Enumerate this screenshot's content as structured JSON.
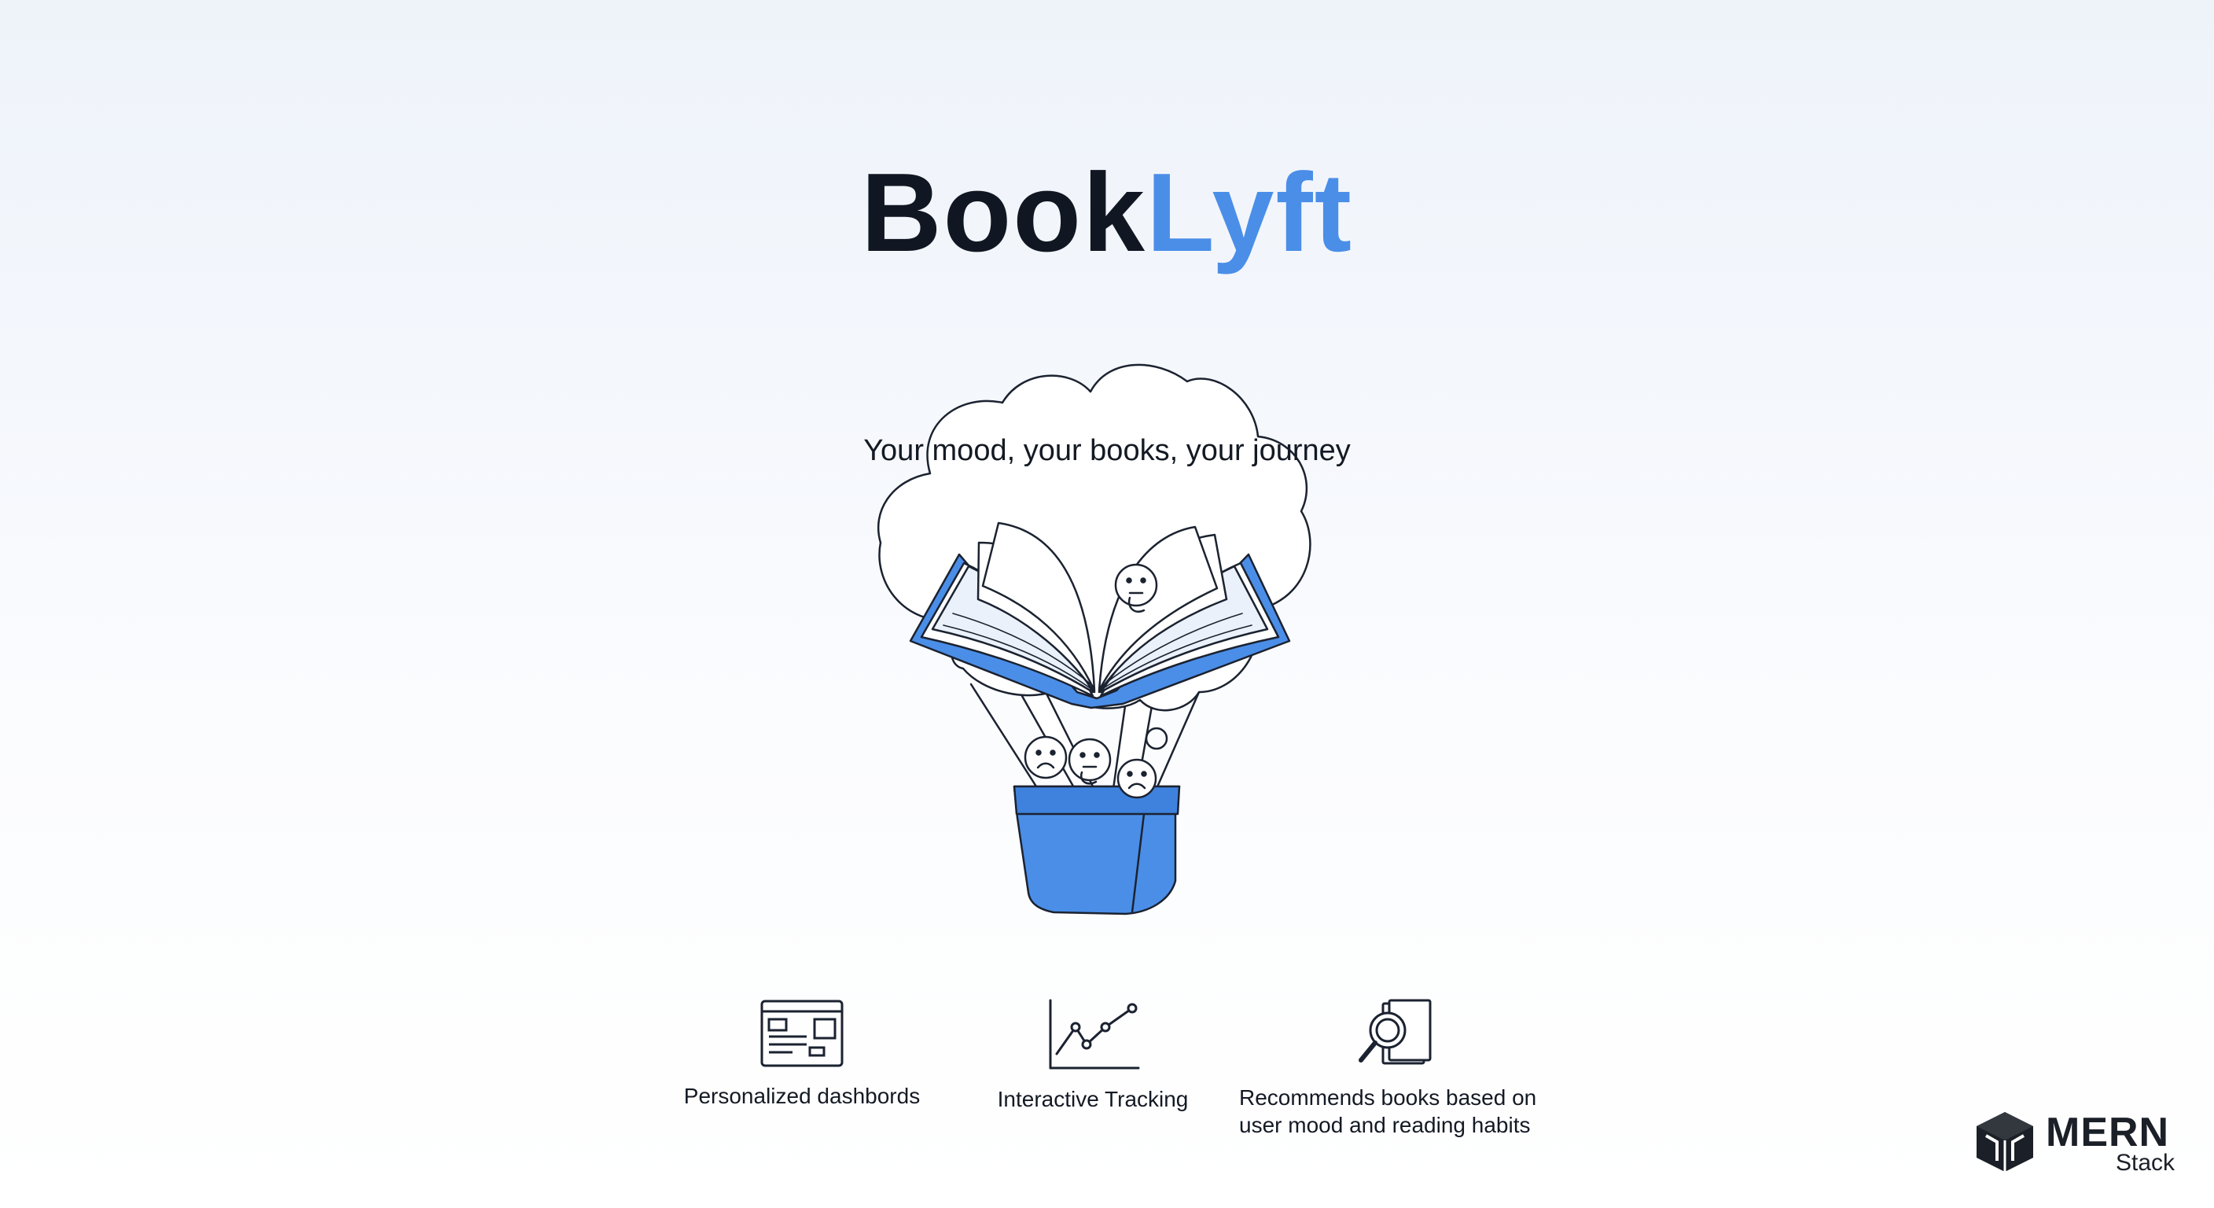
{
  "title": {
    "part1": "Book",
    "part2": "Lyft"
  },
  "tagline": "Your mood, your books, your journey",
  "illustration": {
    "icon": "book-balloon-illustration",
    "colors": {
      "accent": "#4a8ee8",
      "line": "#1b2230"
    }
  },
  "features": [
    {
      "label": "Personalized dashbords",
      "icon": "dashboard-icon"
    },
    {
      "label": "Interactive Tracking",
      "icon": "line-chart-icon"
    },
    {
      "label": "Recommends books based on user mood and reading habits",
      "icon": "book-search-icon"
    }
  ],
  "brand": {
    "name": "MERN",
    "sub": "Stack",
    "icon": "cube-logo-icon"
  },
  "colors": {
    "title_dark": "#111722",
    "title_accent": "#4a8ee8",
    "text": "#141a24"
  }
}
